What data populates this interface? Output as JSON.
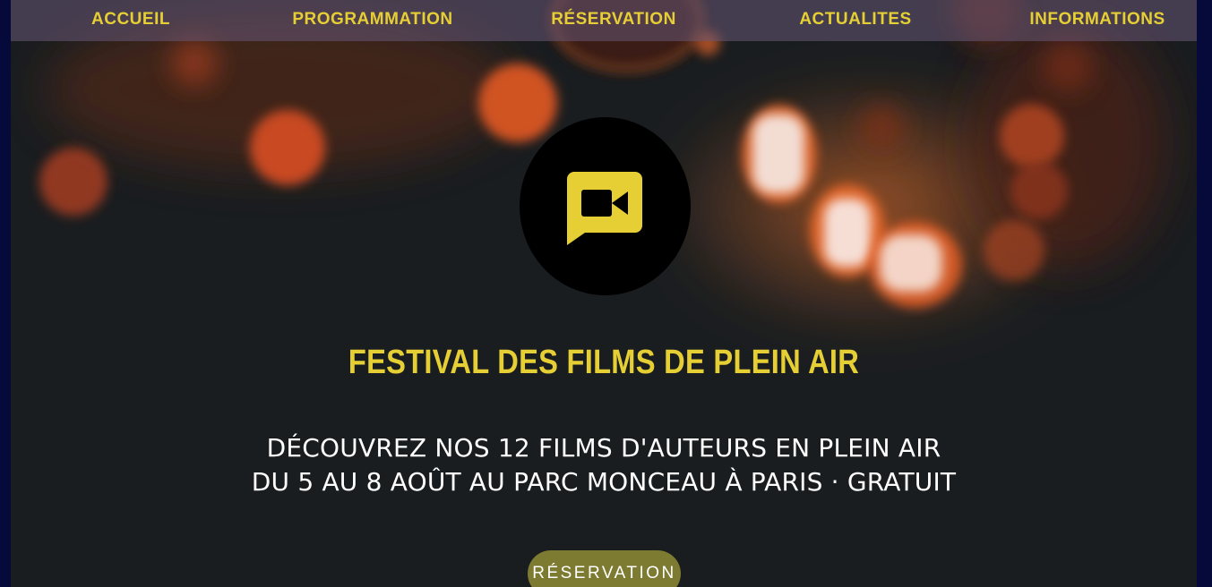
{
  "nav": {
    "items": [
      {
        "label": "ACCUEIL"
      },
      {
        "label": "PROGRAMMATION"
      },
      {
        "label": "RÉSERVATION"
      },
      {
        "label": "ACTUALITES"
      },
      {
        "label": "INFORMATIONS"
      }
    ]
  },
  "hero": {
    "logo_icon": "video-chat-icon",
    "title": "FESTIVAL DES FILMS DE PLEIN AIR",
    "tagline_line1": "DÉCOUVREZ NOS 12 FILMS D'AUTEURS EN PLEIN AIR",
    "tagline_line2": "DU 5 AU 8 AOÛT AU PARC MONCEAU À PARIS · GRATUIT",
    "cta_label": "RÉSERVATION"
  },
  "colors": {
    "accent": "#e6cf35",
    "page_frame": "#060a3a",
    "background": "#1a1d20",
    "navbar": "#685876",
    "button": "#7d7a31"
  }
}
